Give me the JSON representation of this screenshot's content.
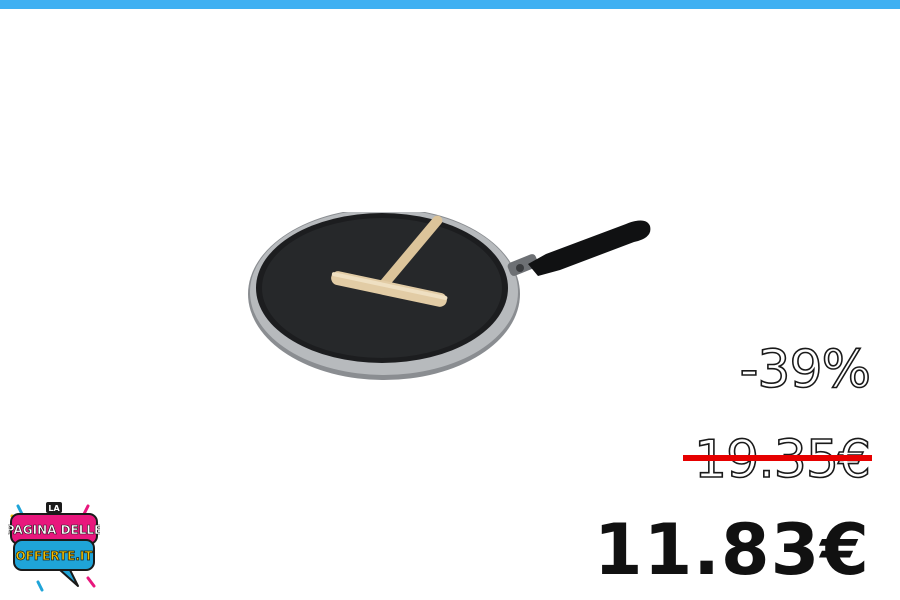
{
  "header": {
    "accent_color": "#3fb0f2"
  },
  "product": {
    "image_icon": "crepe-pan-with-spreader-icon"
  },
  "pricing": {
    "discount": "-39%",
    "old_price": "19.35€",
    "new_price": "11.83€",
    "strike_color": "#e60000"
  },
  "logo": {
    "line1": "LA",
    "line2": "PAGINA DELLE",
    "line3": "OFFERTE.IT",
    "brand_color": "#e8177d",
    "secondary_color": "#1fa4d8"
  }
}
